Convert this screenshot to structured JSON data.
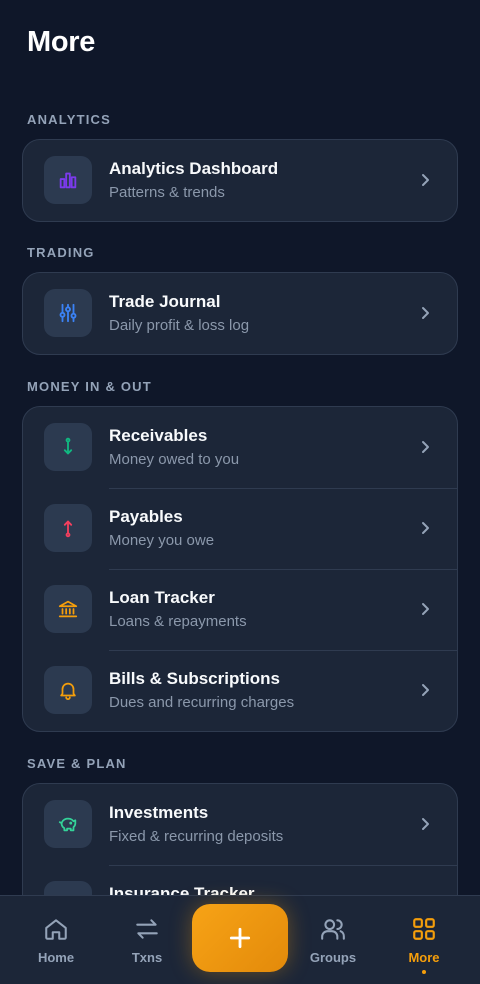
{
  "header": {
    "title": "More"
  },
  "sections": {
    "analytics": {
      "label": "ANALYTICS",
      "items": [
        {
          "title": "Analytics Dashboard",
          "subtitle": "Patterns & trends",
          "icon": "bar-chart-icon",
          "color": "#7c3aed"
        }
      ]
    },
    "trading": {
      "label": "TRADING",
      "items": [
        {
          "title": "Trade Journal",
          "subtitle": "Daily profit & loss log",
          "icon": "sliders-icon",
          "color": "#3b82f6"
        }
      ]
    },
    "money": {
      "label": "MONEY IN & OUT",
      "items": [
        {
          "title": "Receivables",
          "subtitle": "Money owed to you",
          "icon": "arrow-in-icon",
          "color": "#10b981"
        },
        {
          "title": "Payables",
          "subtitle": "Money you owe",
          "icon": "arrow-out-icon",
          "color": "#f43f5e"
        },
        {
          "title": "Loan Tracker",
          "subtitle": "Loans & repayments",
          "icon": "bank-icon",
          "color": "#f59e0b"
        },
        {
          "title": "Bills & Subscriptions",
          "subtitle": "Dues and recurring charges",
          "icon": "bell-icon",
          "color": "#f59e0b"
        }
      ]
    },
    "save": {
      "label": "SAVE & PLAN",
      "items": [
        {
          "title": "Investments",
          "subtitle": "Fixed & recurring deposits",
          "icon": "piggy-bank-icon",
          "color": "#34d399"
        },
        {
          "title": "Insurance Tracker",
          "subtitle": "",
          "icon": "shield-icon",
          "color": "#60a5fa"
        }
      ]
    }
  },
  "nav": {
    "home": "Home",
    "txns": "Txns",
    "groups": "Groups",
    "more": "More",
    "active": "more",
    "accent": "#f59e0b"
  }
}
